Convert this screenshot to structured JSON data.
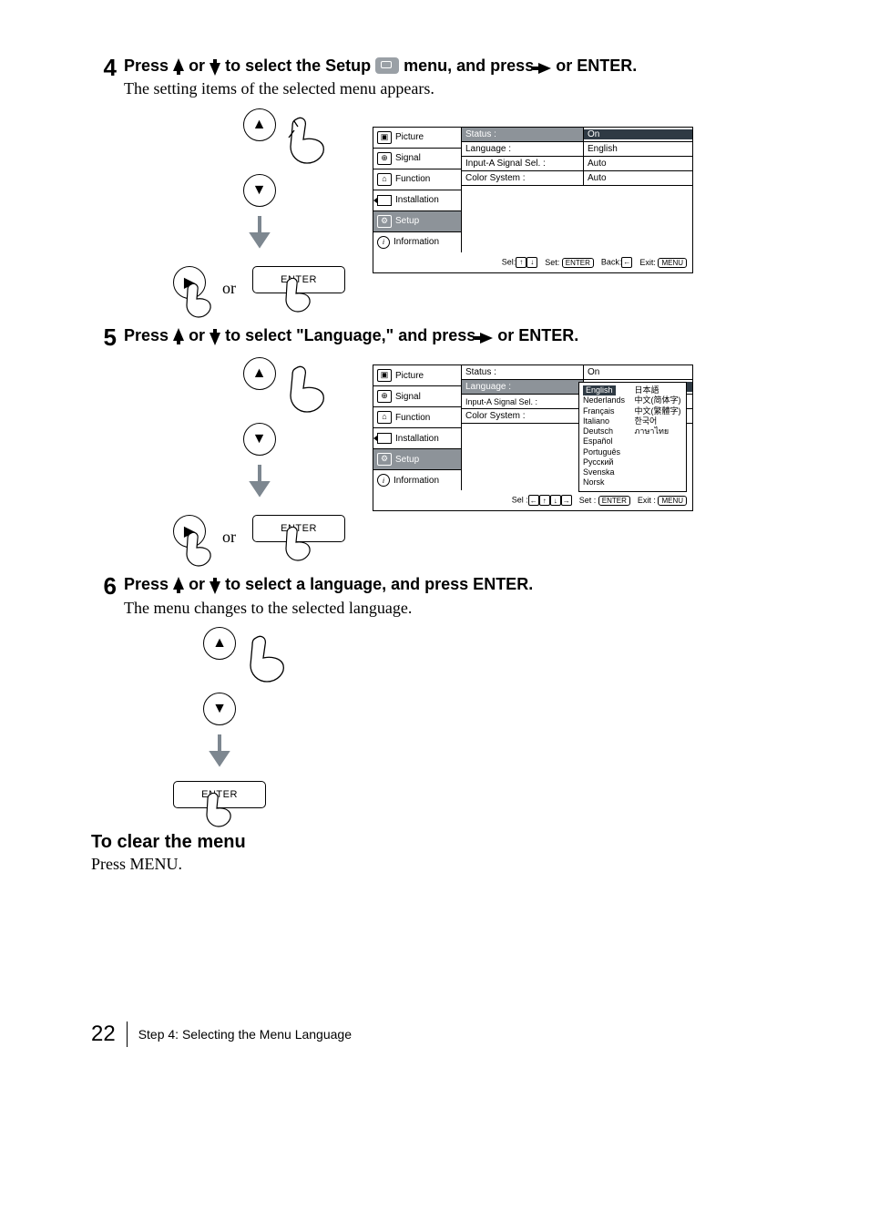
{
  "steps": {
    "s4": {
      "num": "4",
      "text_1": "Press ",
      "text_2": " or ",
      "text_3": " to select the Setup ",
      "text_4": "  menu, and press ",
      "text_5": " or ENTER.",
      "sub": "The setting items of the selected menu appears."
    },
    "s5": {
      "num": "5",
      "text_1": "Press ",
      "text_2": " or ",
      "text_3": " to select \"Language,\" and press ",
      "text_4": " or ENTER."
    },
    "s6": {
      "num": "6",
      "text_1": "Press ",
      "text_2": " or ",
      "text_3": " to select a language, and press ENTER.",
      "sub": "The menu changes to the selected language."
    }
  },
  "controls": {
    "or": "or",
    "enter": "ENTER"
  },
  "osd": {
    "menu_items": {
      "picture": "Picture",
      "signal": "Signal",
      "function": "Function",
      "installation": "Installation",
      "setup": "Setup",
      "information": "Information"
    },
    "kv": {
      "status_k": "Status :",
      "status_v": "On",
      "language_k": "Language :",
      "language_v": "English",
      "inputa_k": "Input-A Signal Sel. :",
      "inputa_v": "Auto",
      "color_k": "Color System :",
      "color_v": "Auto"
    },
    "footer1": {
      "sel": "Sel:",
      "set": "Set:",
      "back": "Back:",
      "exit": "Exit:",
      "enter": "ENTER",
      "menu": "MENU"
    },
    "footer2": {
      "sel": "Sel :",
      "set": "Set :",
      "exit": "Exit :",
      "enter": "ENTER",
      "menu": "MENU"
    },
    "langs": {
      "english": "English",
      "nederlands": "Nederlands",
      "francais": "Français",
      "italiano": "Italiano",
      "deutsch": "Deutsch",
      "espanol": "Español",
      "portugues": "Português",
      "russkiy": "Русский",
      "svenska": "Svenska",
      "norsk": "Norsk",
      "ja": "日本語",
      "zh1": "中文(简体字)",
      "zh2": "中文(繁體字)",
      "ko": "한국어",
      "th": "ภาษาไทย"
    }
  },
  "clear": {
    "heading": "To clear the menu",
    "body": "Press MENU."
  },
  "footer": {
    "page": "22",
    "title": "Step 4: Selecting the Menu Language"
  }
}
